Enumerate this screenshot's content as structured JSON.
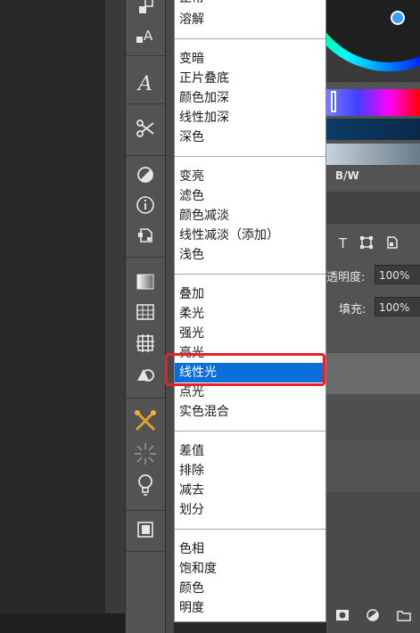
{
  "blend_menu": {
    "items": [
      {
        "label": "正常"
      },
      {
        "label": "溶解"
      },
      {
        "label": "变暗"
      },
      {
        "label": "正片叠底"
      },
      {
        "label": "颜色加深"
      },
      {
        "label": "线性加深"
      },
      {
        "label": "深色"
      },
      {
        "label": "变亮"
      },
      {
        "label": "滤色"
      },
      {
        "label": "颜色减淡"
      },
      {
        "label": "线性减淡（添加）"
      },
      {
        "label": "浅色"
      },
      {
        "label": "叠加"
      },
      {
        "label": "柔光"
      },
      {
        "label": "强光"
      },
      {
        "label": "亮光"
      },
      {
        "label": "线性光"
      },
      {
        "label": "点光"
      },
      {
        "label": "实色混合"
      },
      {
        "label": "差值"
      },
      {
        "label": "排除"
      },
      {
        "label": "减去"
      },
      {
        "label": "划分"
      },
      {
        "label": "色相"
      },
      {
        "label": "饱和度"
      },
      {
        "label": "颜色"
      },
      {
        "label": "明度"
      }
    ],
    "selected": "线性光",
    "highlight_color": "#e8202a",
    "selection_color": "#0a6fd6"
  },
  "toolbar": {
    "tools": [
      {
        "icon": "path-selection-icon"
      },
      {
        "icon": "type-icon"
      },
      {
        "icon": "brush-a-icon"
      },
      {
        "icon": "scissors-path-icon"
      },
      {
        "icon": "contrast-icon"
      },
      {
        "icon": "info-icon"
      },
      {
        "icon": "3d-cube-icon"
      },
      {
        "icon": "gradient-icon"
      },
      {
        "icon": "grid-icon"
      },
      {
        "icon": "hash-grid-icon"
      },
      {
        "icon": "shapes-icon"
      },
      {
        "icon": "crossed-brushes-icon"
      },
      {
        "icon": "burst-icon"
      },
      {
        "icon": "lightbulb-icon"
      },
      {
        "icon": "book-icon"
      }
    ]
  },
  "right_panel": {
    "bw_label": "B/W",
    "opacity_label": "透明度:",
    "opacity_value": "100%",
    "fill_label": "填充:",
    "fill_value": "100%"
  }
}
